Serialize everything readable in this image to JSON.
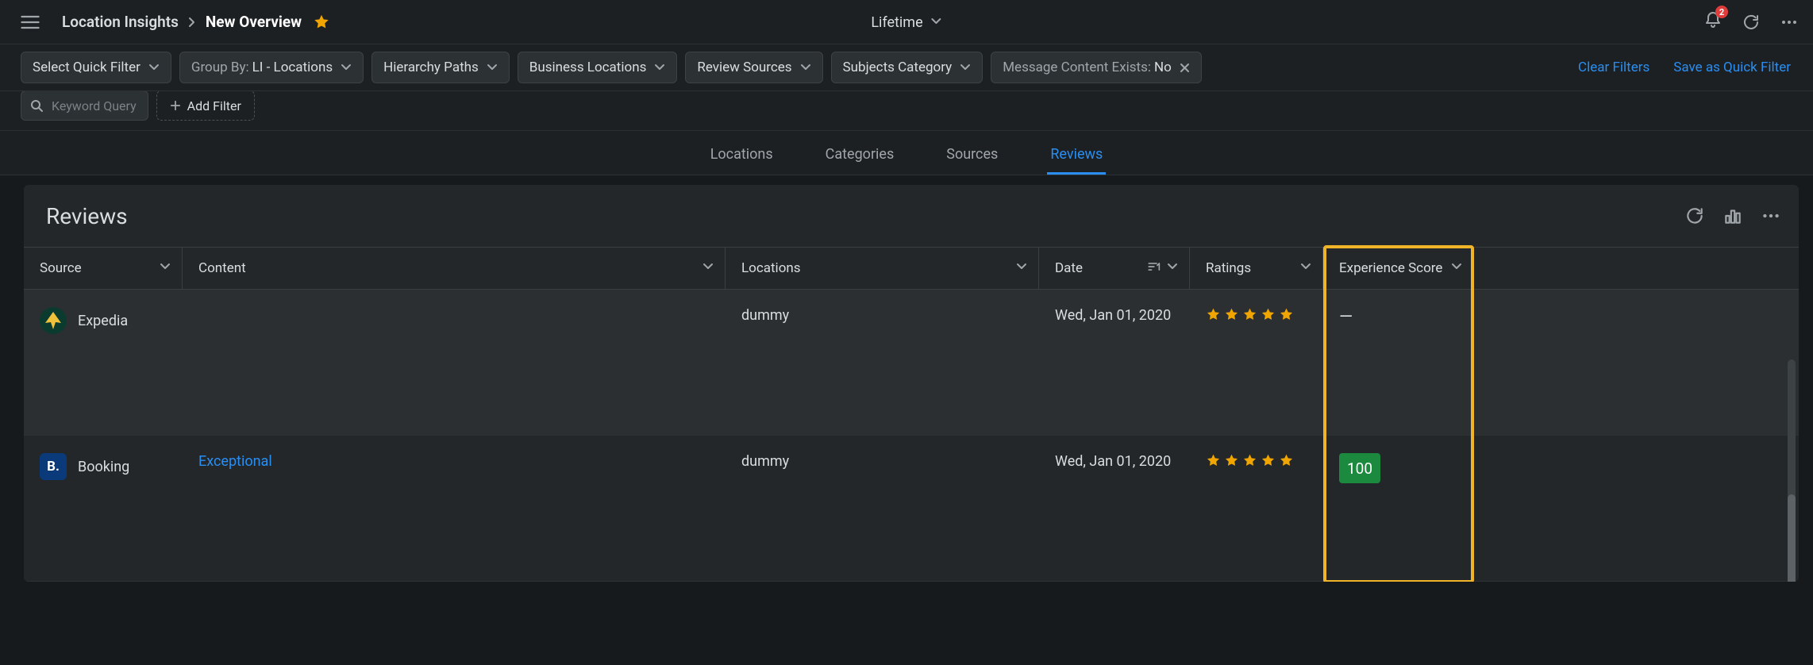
{
  "header": {
    "breadcrumb_root": "Location Insights",
    "breadcrumb_current": "New Overview",
    "date_range": "Lifetime",
    "notification_count": "2"
  },
  "filters": {
    "quick_filter": "Select Quick Filter",
    "group_by_prefix": "Group By:",
    "group_by_value": "LI - Locations",
    "hierarchy": "Hierarchy Paths",
    "business_loc": "Business Locations",
    "review_sources": "Review Sources",
    "subjects_cat": "Subjects Category",
    "msg_content_prefix": "Message Content Exists:",
    "msg_content_value": "No",
    "keyword_placeholder": "Keyword Query",
    "add_filter": "Add Filter",
    "clear_filters": "Clear Filters",
    "save_quick": "Save as Quick Filter"
  },
  "tabs": {
    "locations": "Locations",
    "categories": "Categories",
    "sources": "Sources",
    "reviews": "Reviews"
  },
  "panel": {
    "title": "Reviews"
  },
  "columns": {
    "source": "Source",
    "content": "Content",
    "locations": "Locations",
    "date": "Date",
    "ratings": "Ratings",
    "experience": "Experience Score"
  },
  "rows": [
    {
      "source": "Expedia",
      "source_kind": "expedia",
      "content": "",
      "location": "dummy",
      "date": "Wed, Jan 01, 2020",
      "rating": 5,
      "experience": "—"
    },
    {
      "source": "Booking",
      "source_kind": "booking",
      "content": "Exceptional",
      "location": "dummy",
      "date": "Wed, Jan 01, 2020",
      "rating": 5,
      "experience": "100"
    }
  ]
}
